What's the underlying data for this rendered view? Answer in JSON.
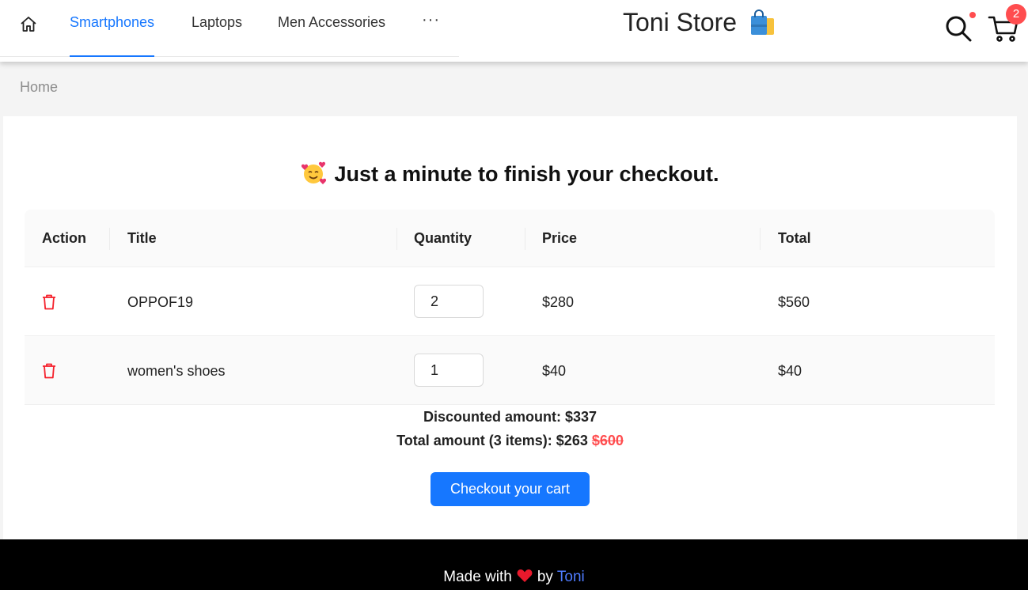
{
  "header": {
    "nav": {
      "home_icon": "home-icon",
      "items": [
        {
          "label": "Smartphones",
          "active": true
        },
        {
          "label": "Laptops",
          "active": false
        },
        {
          "label": "Men Accessories",
          "active": false
        }
      ],
      "more": "···"
    },
    "brand": {
      "title": "Toni Store",
      "icon": "shopping-bag-icon"
    },
    "search_icon": "search-icon",
    "cart": {
      "icon": "cart-icon",
      "count": "2"
    }
  },
  "breadcrumb": {
    "home": "Home"
  },
  "checkout": {
    "heading": "Just a minute to finish your checkout.",
    "heading_icon": "smiling-face-with-hearts-icon",
    "columns": [
      "Action",
      "Title",
      "Quantity",
      "Price",
      "Total"
    ],
    "rows": [
      {
        "title": "OPPOF19",
        "quantity": "2",
        "price": "$280",
        "total": "$560"
      },
      {
        "title": "women's shoes",
        "quantity": "1",
        "price": "$40",
        "total": "$40"
      }
    ],
    "discount_label": "Discounted amount:",
    "discount_value": "$337",
    "total_label": "Total amount (3 items):",
    "total_value": "$263",
    "original_total": "$600",
    "button": "Checkout your cart"
  },
  "footer": {
    "made_with": "Made with",
    "by": "by",
    "author": "Toni",
    "heart_icon": "heart-icon"
  },
  "colors": {
    "accent": "#1677ff",
    "danger": "#ff4d4f",
    "footer_bg": "#000000"
  }
}
